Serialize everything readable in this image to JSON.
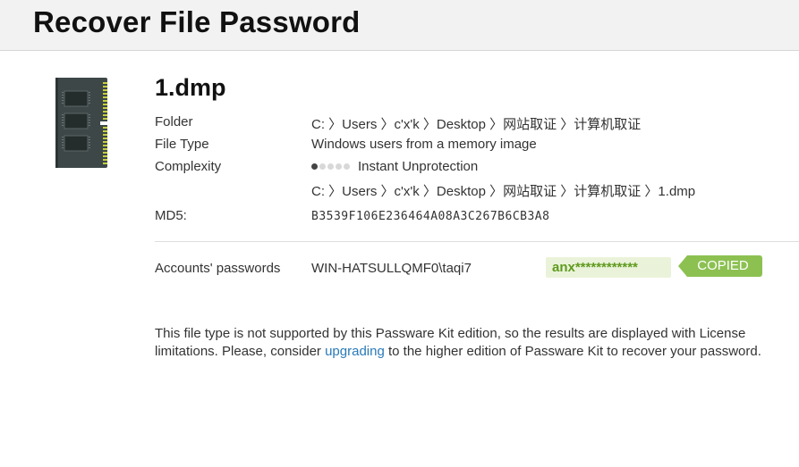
{
  "header": {
    "title": "Recover File Password"
  },
  "file": {
    "name": "1.dmp",
    "icon": "memory-module-icon",
    "details": {
      "folder_label": "Folder",
      "folder_value": "C: 〉Users 〉c'x'k 〉Desktop 〉网站取证 〉计算机取证",
      "filetype_label": "File Type",
      "filetype_value": "Windows users from a memory image",
      "complexity_label": "Complexity",
      "complexity_value": "Instant Unprotection",
      "complexity_level": 1,
      "complexity_max": 5,
      "path_value": "C: 〉Users 〉c'x'k 〉Desktop 〉网站取证 〉计算机取证 〉1.dmp",
      "md5_label": "MD5:",
      "md5_value": "B3539F106E236464A08A3C267B6CB3A8"
    }
  },
  "accounts": {
    "label": "Accounts' passwords",
    "account_name": "WIN-HATSULLQMF0\\taqi7",
    "password_masked": "anx************",
    "copied_label": "COPIED"
  },
  "notice": {
    "line1": "This file type is not supported by this Passware Kit edition, so the results are displayed with License",
    "line2_before": "limitations. Please, consider ",
    "link_text": "upgrading",
    "line2_after": " to the higher edition of Passware Kit to recover your password."
  },
  "colors": {
    "header_bg": "#f2f2f2",
    "password_text": "#5f9a1e",
    "password_bg": "#eaf3d9",
    "copied_bg": "#8cc152",
    "link": "#2a7ab8"
  }
}
